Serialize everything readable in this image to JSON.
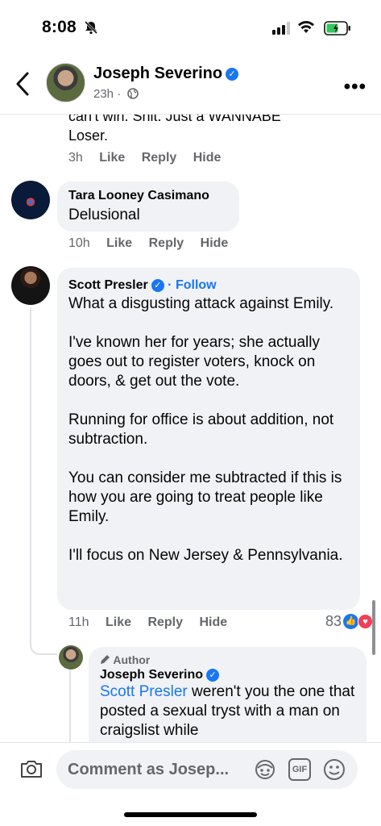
{
  "status_bar": {
    "time": "8:08"
  },
  "header": {
    "name": "Joseph Severino",
    "subtitle": "23h ·"
  },
  "comments": [
    {
      "id": "c0",
      "text_cut": "can't win. Shit. Just a WANNABE Loser.",
      "time": "3h",
      "actions": [
        "Like",
        "Reply",
        "Hide"
      ]
    },
    {
      "id": "c1",
      "name": "Tara Looney Casimano",
      "text": "Delusional",
      "time": "10h",
      "actions": [
        "Like",
        "Reply",
        "Hide"
      ]
    },
    {
      "id": "c2",
      "name": "Scott Presler",
      "follow": "· Follow",
      "paragraphs": [
        "What a disgusting attack against Emily.",
        "I've known her for years; she actually goes out to register voters, knock on doors, & get out the vote.",
        "Running for office is about addition, not subtraction.",
        "You can consider me subtracted if this is how you are going to treat people like Emily.",
        "I'll focus on New Jersey & Pennsylvania."
      ],
      "time": "11h",
      "actions": [
        "Like",
        "Reply",
        "Hide"
      ],
      "reaction_count": "83"
    },
    {
      "id": "c3",
      "badge": "Author",
      "name": "Joseph Severino",
      "mention": "Scott Presler",
      "text": " weren't you the one that posted a sexual tryst with a man on craigslist while"
    }
  ],
  "composer": {
    "placeholder": "Comment as Josep...",
    "gif_label": "GIF"
  },
  "icons": [
    "back-icon",
    "globe-icon",
    "more-icon",
    "camera-icon",
    "avatar-sticker-icon",
    "gif-icon",
    "emoji-icon",
    "bell-slash-icon",
    "verified-icon",
    "like-reaction-icon",
    "love-reaction-icon",
    "pencil-icon"
  ],
  "colors": {
    "accent": "#1877f2",
    "bubble": "#f0f2f5",
    "muted": "#65676b",
    "love": "#f33e58"
  }
}
